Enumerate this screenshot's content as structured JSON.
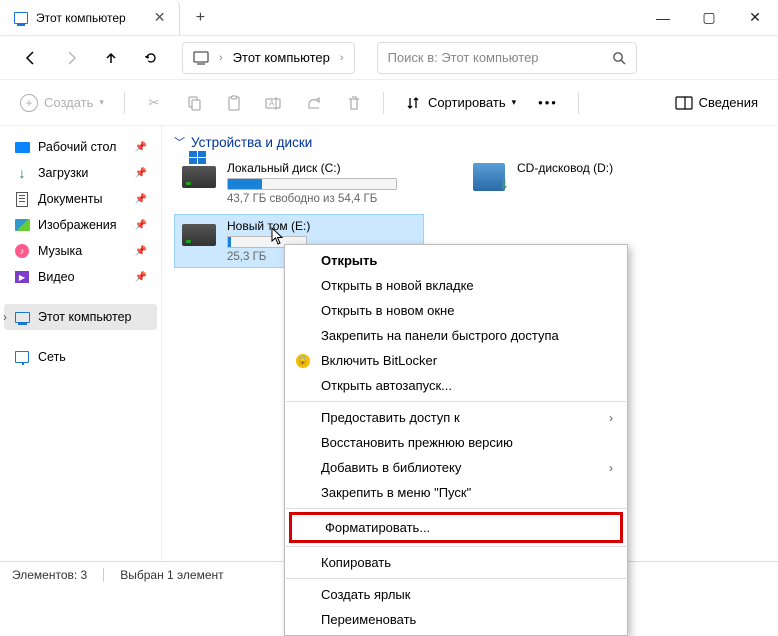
{
  "titlebar": {
    "tab_title": "Этот компьютер"
  },
  "nav": {
    "path_segment": "Этот компьютер",
    "search_placeholder": "Поиск в: Этот компьютер"
  },
  "toolbar": {
    "create": "Создать",
    "sort": "Сортировать",
    "details": "Сведения"
  },
  "sidebar": {
    "items": [
      {
        "label": "Рабочий стол",
        "pinned": true
      },
      {
        "label": "Загрузки",
        "pinned": true
      },
      {
        "label": "Документы",
        "pinned": true
      },
      {
        "label": "Изображения",
        "pinned": true
      },
      {
        "label": "Музыка",
        "pinned": true
      },
      {
        "label": "Видео",
        "pinned": true
      },
      {
        "label": "Этот компьютер",
        "pinned": false
      },
      {
        "label": "Сеть",
        "pinned": false
      }
    ]
  },
  "content": {
    "group_title": "Устройства и диски",
    "drives": [
      {
        "name": "Локальный диск (C:)",
        "stats": "43,7 ГБ свободно из 54,4 ГБ",
        "fill_pct": 20
      },
      {
        "name": "CD-дисковод (D:)"
      },
      {
        "name": "Новый том (E:)",
        "stats": "25,3 ГБ",
        "fill_pct": 4
      }
    ]
  },
  "context_menu": {
    "items": {
      "open": "Открыть",
      "new_tab": "Открыть в новой вкладке",
      "new_window": "Открыть в новом окне",
      "pin_quick": "Закрепить на панели быстрого доступа",
      "bitlocker": "Включить BitLocker",
      "autoplay": "Открыть автозапуск...",
      "share": "Предоставить доступ к",
      "restore": "Восстановить прежнюю версию",
      "library": "Добавить в библиотеку",
      "pin_start": "Закрепить в меню \"Пуск\"",
      "format": "Форматировать...",
      "copy": "Копировать",
      "shortcut": "Создать ярлык",
      "rename": "Переименовать"
    }
  },
  "statusbar": {
    "count": "Элементов: 3",
    "selection": "Выбран 1 элемент"
  }
}
